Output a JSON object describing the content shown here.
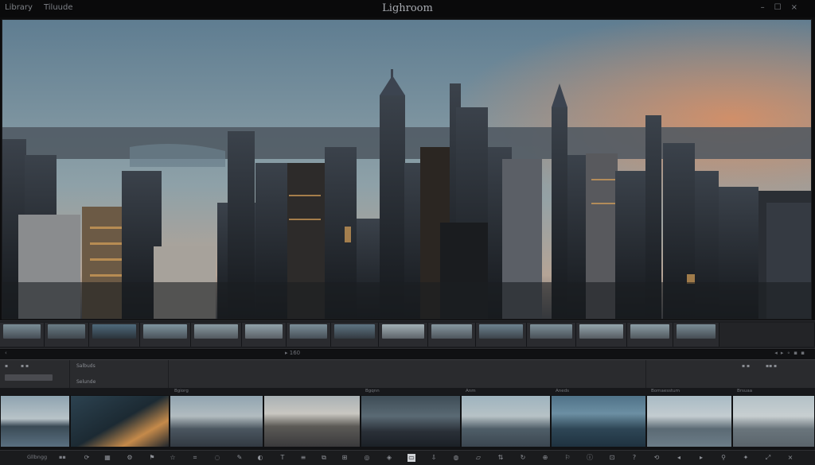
{
  "app": {
    "title": "Lighroom",
    "menu": [
      "Library",
      "Tiluude"
    ],
    "top_right": [
      "–",
      "☐",
      "×"
    ]
  },
  "info": {
    "left": "‹",
    "mid": "▸ 160",
    "right": "◂ ▸ ∘ ▪ ▪"
  },
  "toolbar": {
    "left_items": [
      "▪",
      "▪ ▪",
      "Salbuds",
      "Selunde"
    ],
    "right_items": [
      "▪ ▪",
      "▪▪ ▪"
    ]
  },
  "filmstrip_top": {
    "labels": [
      "",
      "",
      "",
      "",
      "",
      "",
      "",
      "",
      "",
      "",
      "",
      "",
      "",
      "",
      ""
    ]
  },
  "filmstrip_bottom": {
    "captions": [
      "",
      "",
      "Bgiorg",
      "",
      "Bgqnn",
      "Anm",
      "Aneds",
      "Bomaesstum",
      "Brsuaa"
    ]
  },
  "bottom": {
    "left_labels": [
      "Gllbngg",
      "▪▪"
    ],
    "icons": [
      "sync-icon",
      "grid-icon",
      "gear-icon",
      "flag-icon",
      "star-icon",
      "crop-icon",
      "heal-icon",
      "brush-icon",
      "gradient-icon",
      "text-icon",
      "list-icon",
      "compare-icon",
      "survey-icon",
      "loupe-icon",
      "tag-icon",
      "export-icon",
      "import-icon",
      "color-icon",
      "folder-icon",
      "sort-icon",
      "rotate-icon",
      "zoom-icon",
      "flag2-icon",
      "info-icon",
      "lock-icon",
      "help-icon",
      "sync2-icon",
      "close-icon"
    ]
  }
}
